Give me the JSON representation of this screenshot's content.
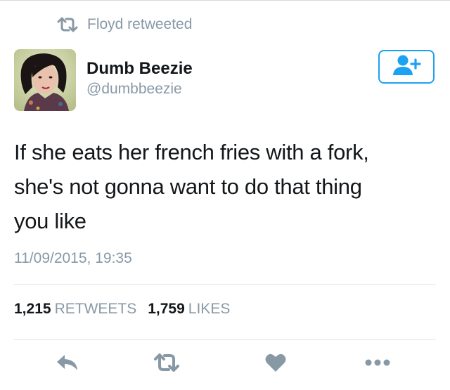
{
  "colors": {
    "muted": "#8899a6",
    "text": "#14171a",
    "accent": "#1da1f2",
    "divider": "#e1e8ed"
  },
  "retweet_context": {
    "icon": "retweet-icon",
    "text": "Floyd retweeted"
  },
  "author": {
    "name": "Dumb Beezie",
    "handle": "@dumbbeezie",
    "avatar": "avatar-photo"
  },
  "follow_button": {
    "icon": "add-user-icon"
  },
  "tweet": {
    "lines": [
      "If she eats her french fries with a fork,",
      "she's not gonna want to do that thing",
      "you like"
    ],
    "timestamp": "11/09/2015, 19:35"
  },
  "stats": {
    "retweets": {
      "count": "1,215",
      "label": "RETWEETS"
    },
    "likes": {
      "count": "1,759",
      "label": "LIKES"
    }
  },
  "actions": [
    {
      "icon": "reply-icon"
    },
    {
      "icon": "retweet-icon"
    },
    {
      "icon": "heart-icon"
    },
    {
      "icon": "more-icon"
    }
  ]
}
